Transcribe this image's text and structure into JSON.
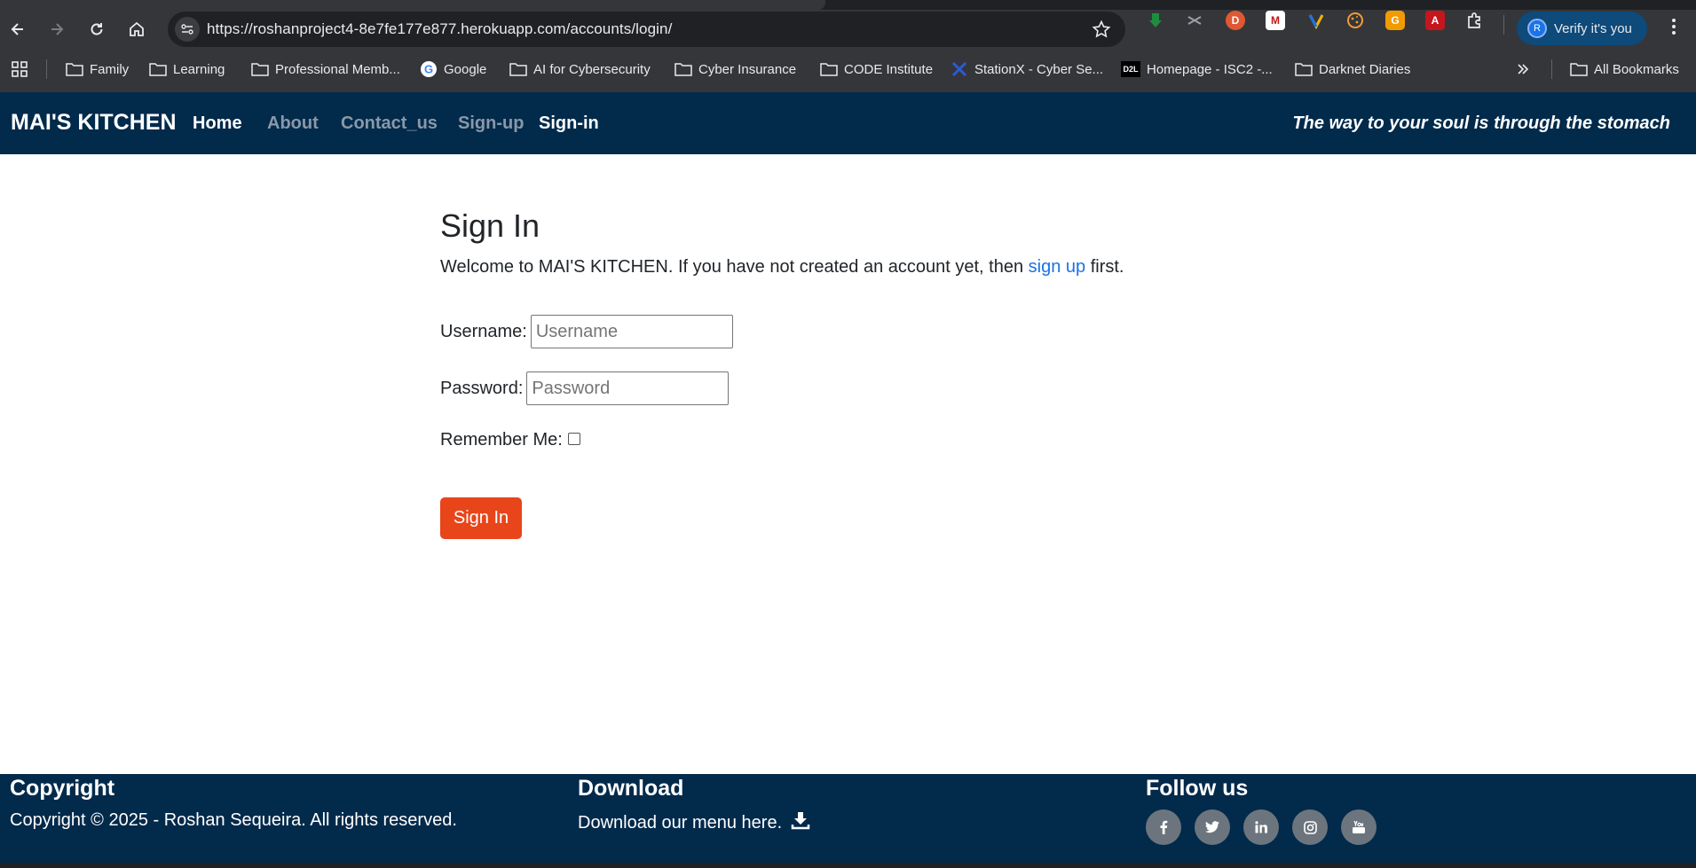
{
  "browser": {
    "url": "https://roshanproject4-8e7fe177e877.herokuapp.com/accounts/login/",
    "verify_label": "Verify it's you",
    "profile_initial": "R",
    "bookmarks": [
      {
        "label": "Family",
        "icon": "folder-icon"
      },
      {
        "label": "Learning",
        "icon": "folder-icon"
      },
      {
        "label": "Professional Memb...",
        "icon": "folder-icon"
      },
      {
        "label": "Google",
        "icon": "google-icon"
      },
      {
        "label": "AI for Cybersecurity",
        "icon": "folder-icon"
      },
      {
        "label": "Cyber Insurance",
        "icon": "folder-icon"
      },
      {
        "label": "CODE Institute",
        "icon": "folder-icon"
      },
      {
        "label": "StationX - Cyber Se...",
        "icon": "stationx-icon"
      },
      {
        "label": "Homepage - ISC2 -...",
        "icon": "d2l-icon"
      },
      {
        "label": "Darknet Diaries",
        "icon": "folder-icon"
      }
    ],
    "all_bookmarks_label": "All Bookmarks",
    "d2l_badge": "D2L"
  },
  "navbar": {
    "brand": "MAI'S KITCHEN",
    "links": [
      "Home",
      "About",
      "Contact_us",
      "Sign-up",
      "Sign-in"
    ],
    "tagline": "The way to your soul is through the stomach"
  },
  "signin": {
    "title": "Sign In",
    "welcome_before": "Welcome to MAI'S KITCHEN. If you have not created an account yet, then ",
    "welcome_link": "sign up",
    "welcome_after": " first.",
    "username_label": "Username:",
    "username_placeholder": "Username",
    "password_label": "Password:",
    "password_placeholder": "Password",
    "remember_label": "Remember Me:",
    "button_label": "Sign In"
  },
  "footer": {
    "copyright_heading": "Copyright",
    "copyright_text": "Copyright © 2025 - Roshan Sequeira. All rights reserved.",
    "download_heading": "Download",
    "download_text": "Download our menu here.",
    "follow_heading": "Follow us",
    "social": [
      "f",
      "t",
      "in",
      "ig",
      "yt"
    ]
  },
  "colors": {
    "navbar_bg": "#022a4b",
    "button_bg": "#e8451a",
    "link": "#1a73e8",
    "social_bg": "#6c757d"
  }
}
